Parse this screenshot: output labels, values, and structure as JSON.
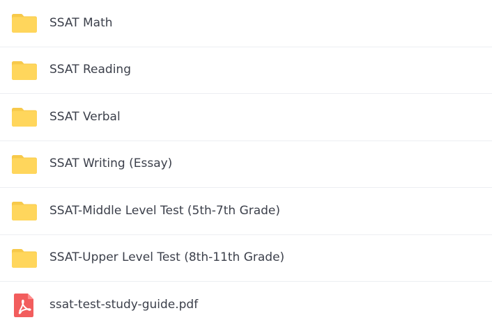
{
  "items": [
    {
      "name": "SSAT Math",
      "type": "folder",
      "icon": "folder-icon"
    },
    {
      "name": "SSAT Reading",
      "type": "folder",
      "icon": "folder-icon"
    },
    {
      "name": "SSAT Verbal",
      "type": "folder",
      "icon": "folder-icon"
    },
    {
      "name": "SSAT Writing (Essay)",
      "type": "folder",
      "icon": "folder-icon"
    },
    {
      "name": "SSAT-Middle Level Test (5th-7th Grade)",
      "type": "folder",
      "icon": "folder-icon"
    },
    {
      "name": "SSAT-Upper Level Test (8th-11th Grade)",
      "type": "folder",
      "icon": "folder-icon"
    },
    {
      "name": "ssat-test-study-guide.pdf",
      "type": "pdf",
      "icon": "pdf-file-icon"
    }
  ],
  "colors": {
    "folder_back": "#f7c94a",
    "folder_front": "#ffd65c",
    "pdf_red": "#f25d5d",
    "divider": "#eceef2",
    "text": "#3b3f4a"
  }
}
